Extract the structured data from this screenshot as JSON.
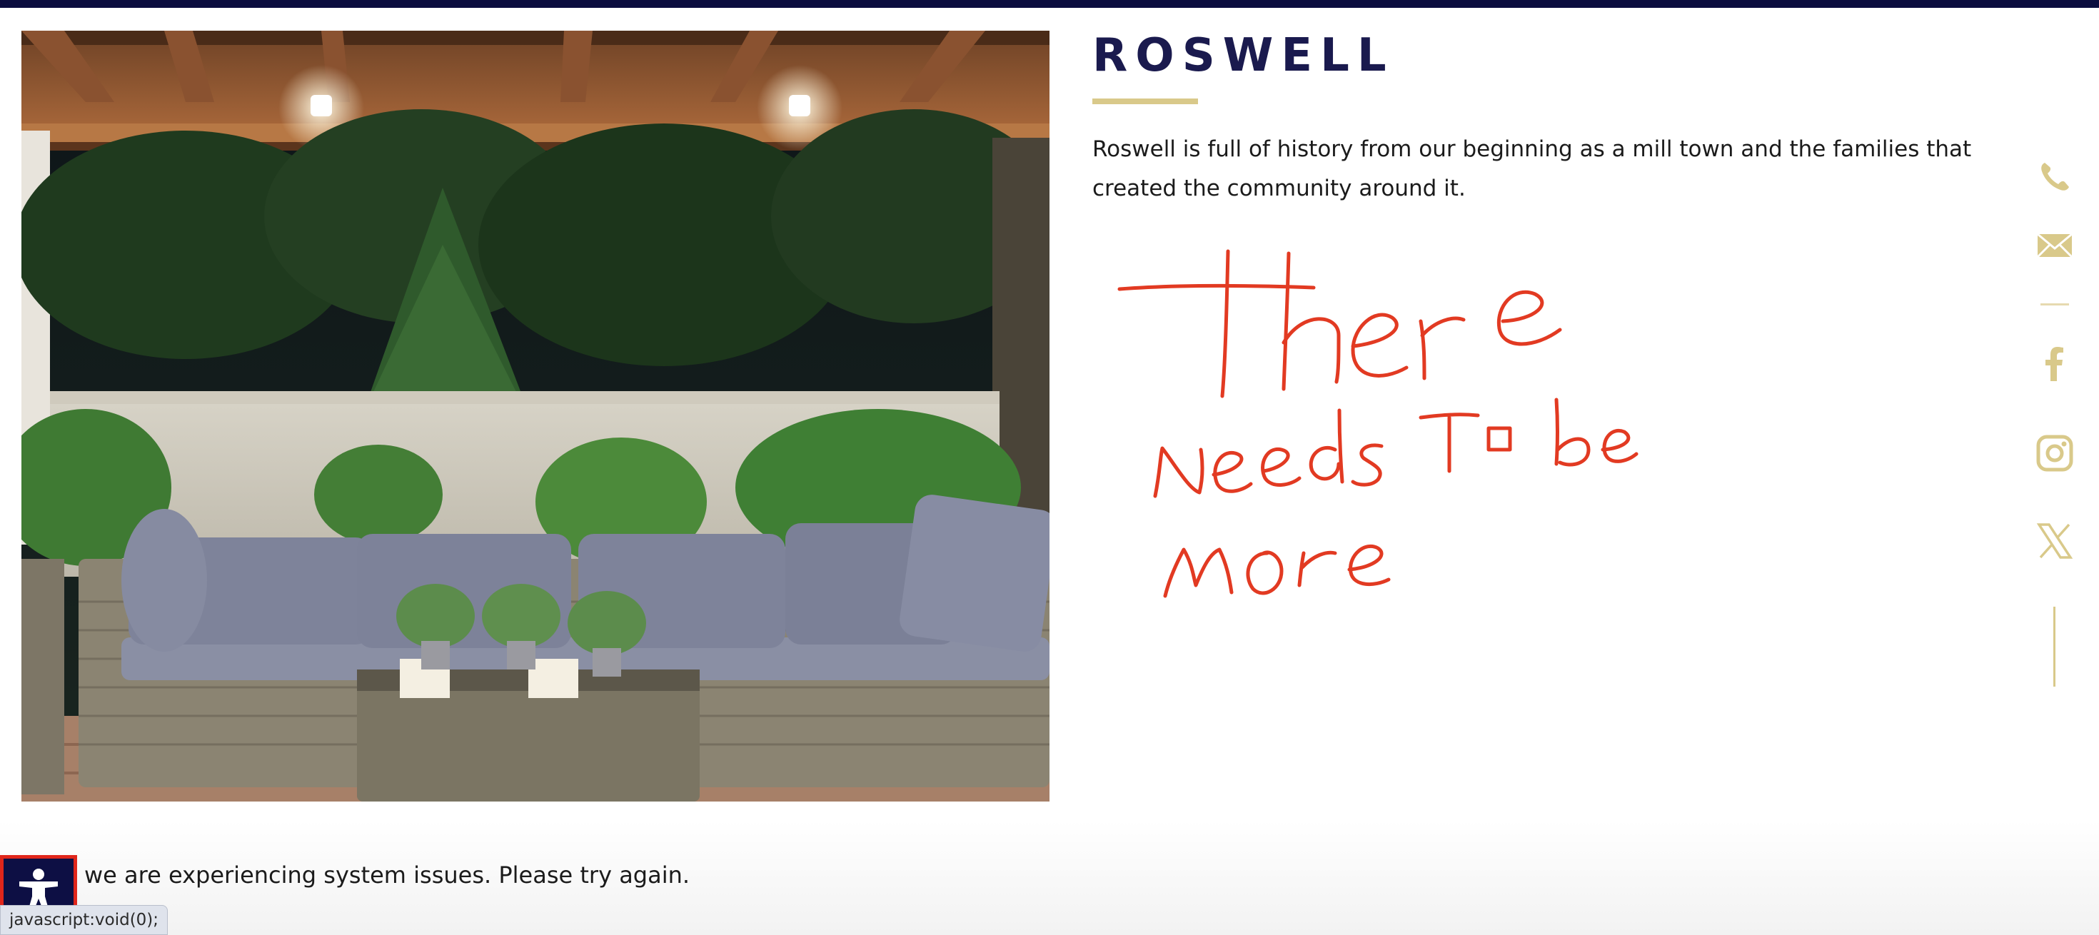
{
  "header": {
    "accent_color": "#0b0d3f"
  },
  "location": {
    "title": "ROSWELL",
    "description": "Roswell is full of history from our beginning as a mill town and the families that created the community around it.",
    "underline_color": "#d9c98a"
  },
  "annotation": {
    "lines": [
      "There",
      "needs To be",
      "more"
    ],
    "color": "#e23a22"
  },
  "social": {
    "icons": [
      "phone-icon",
      "email-icon",
      "facebook-icon",
      "instagram-icon",
      "x-icon"
    ],
    "icon_color": "#d9c98a"
  },
  "notice": {
    "message": "we are experiencing system issues. Please try again."
  },
  "accessibility": {
    "icon": "accessibility-icon"
  },
  "status_bar": {
    "url": "javascript:void(0);"
  }
}
